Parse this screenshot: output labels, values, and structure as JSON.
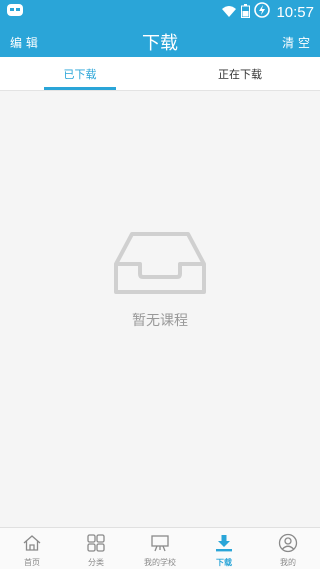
{
  "status": {
    "time": "10:57"
  },
  "appbar": {
    "edit_label": "编 辑",
    "title": "下载",
    "clear_label": "清 空"
  },
  "tabs": [
    {
      "label": "已下载",
      "active": true
    },
    {
      "label": "正在下载",
      "active": false
    }
  ],
  "empty_state": {
    "message": "暂无课程"
  },
  "bottom_nav": [
    {
      "label": "首页",
      "icon": "home-icon",
      "active": false
    },
    {
      "label": "分类",
      "icon": "grid-icon",
      "active": false
    },
    {
      "label": "我的学校",
      "icon": "school-board-icon",
      "active": false
    },
    {
      "label": "下载",
      "icon": "download-icon",
      "active": true
    },
    {
      "label": "我的",
      "icon": "user-icon",
      "active": false
    }
  ],
  "colors": {
    "primary": "#2aa5d8",
    "muted": "#999999"
  }
}
